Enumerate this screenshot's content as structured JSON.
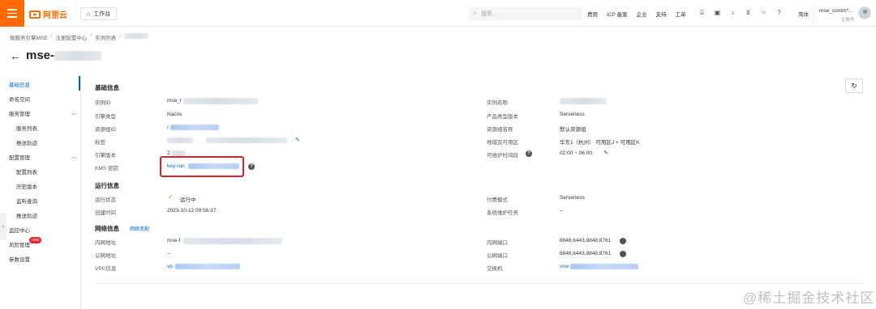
{
  "topbar": {
    "logo_text": "阿里云",
    "workbench": "工作台",
    "search_placeholder": "搜索...",
    "links": [
      "费用",
      "ICP 备案",
      "企业",
      "支持",
      "工单"
    ],
    "lang": "简体",
    "account_name": "mse_comm*...",
    "account_sub": "主账号"
  },
  "breadcrumb": [
    "微服务引擎MSE",
    "注册配置中心",
    "实例列表"
  ],
  "title_prefix": "mse-",
  "sidebar": {
    "items": [
      {
        "label": "基础信息",
        "active": true
      },
      {
        "label": "命名空间"
      },
      {
        "label": "服务管理"
      },
      {
        "label": "服务列表"
      },
      {
        "label": "推送轨迹"
      },
      {
        "label": "配置管理"
      },
      {
        "label": "配置列表"
      },
      {
        "label": "历史版本"
      },
      {
        "label": "监听查询"
      },
      {
        "label": "推送轨迹"
      },
      {
        "label": "监控中心"
      },
      {
        "label": "风险管理"
      },
      {
        "label": "参数设置"
      }
    ],
    "new_badge": "new"
  },
  "basic": {
    "title": "基础信息",
    "left": [
      {
        "label": "实例ID",
        "value": "mse_r"
      },
      {
        "label": "引擎类型",
        "value": "Nacos"
      },
      {
        "label": "资源组ID",
        "value": "r"
      },
      {
        "label": "标签",
        "value": ""
      },
      {
        "label": "引擎版本",
        "value": "2"
      },
      {
        "label": "KMS 密钥",
        "value": "key-run"
      }
    ],
    "right": [
      {
        "label": "实例名称",
        "value": ""
      },
      {
        "label": "产品类型版本",
        "value": "Serverless"
      },
      {
        "label": "资源组名称",
        "value": "默认资源组"
      },
      {
        "label": "地域及可用区",
        "value": "华东1（杭州）  可用区J + 可用区K"
      },
      {
        "label": "可维护时间段",
        "value": "02:00 ~ 06:00"
      }
    ]
  },
  "runtime": {
    "title": "运行信息",
    "status_label": "运行状态",
    "status_value": "运行中",
    "created_label": "创建时间",
    "created_value": "2023-10-12 09:56:37",
    "pay_label": "付费模式",
    "pay_value": "Serverless",
    "maint_label": "系统维护任务",
    "maint_value": "--"
  },
  "network": {
    "title": "网络信息",
    "change_link": "网络变配",
    "left": [
      {
        "label": "内网地址",
        "value": "mse-f"
      },
      {
        "label": "公网地址",
        "value": "--"
      },
      {
        "label": "VPC信息",
        "value": "vp"
      }
    ],
    "right": [
      {
        "label": "内网端口",
        "value": "8848,6443,9848,8761"
      },
      {
        "label": "公网端口",
        "value": "8848,6443,9848,8761"
      },
      {
        "label": "交换机",
        "value": "vsw"
      }
    ]
  },
  "watermark": "@稀土掘金技术社区"
}
